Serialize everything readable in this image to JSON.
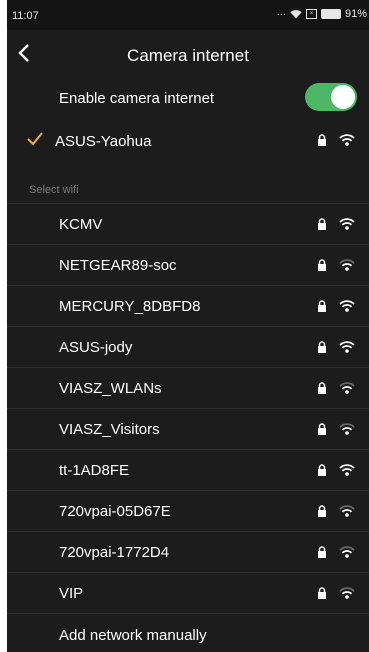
{
  "status_bar": {
    "time": "11:07",
    "dots": "...",
    "battery": "91%"
  },
  "header": {
    "title": "Camera internet"
  },
  "enable": {
    "label": "Enable camera internet",
    "enabled": true
  },
  "connected": {
    "ssid": "ASUS-Yaohua"
  },
  "section": {
    "label": "Select wifi"
  },
  "networks": [
    {
      "ssid": "KCMV",
      "secured": true,
      "signal": "full"
    },
    {
      "ssid": "NETGEAR89-soc",
      "secured": true,
      "signal": "weak"
    },
    {
      "ssid": "MERCURY_8DBFD8",
      "secured": true,
      "signal": "full"
    },
    {
      "ssid": "ASUS-jody",
      "secured": true,
      "signal": "full"
    },
    {
      "ssid": "VIASZ_WLANs",
      "secured": true,
      "signal": "weak"
    },
    {
      "ssid": "VIASZ_Visitors",
      "secured": true,
      "signal": "weak"
    },
    {
      "ssid": "tt-1AD8FE",
      "secured": true,
      "signal": "full"
    },
    {
      "ssid": "720vpai-05D67E",
      "secured": true,
      "signal": "weak"
    },
    {
      "ssid": "720vpai-1772D4",
      "secured": true,
      "signal": "weak"
    },
    {
      "ssid": "VIP",
      "secured": true,
      "signal": "weak"
    }
  ],
  "add_network": {
    "label": "Add network manually"
  },
  "colors": {
    "background": "#1c1c1c",
    "toggle_on": "#4cb865",
    "check": "#e8b04a",
    "section_text": "#7a7a7a"
  }
}
